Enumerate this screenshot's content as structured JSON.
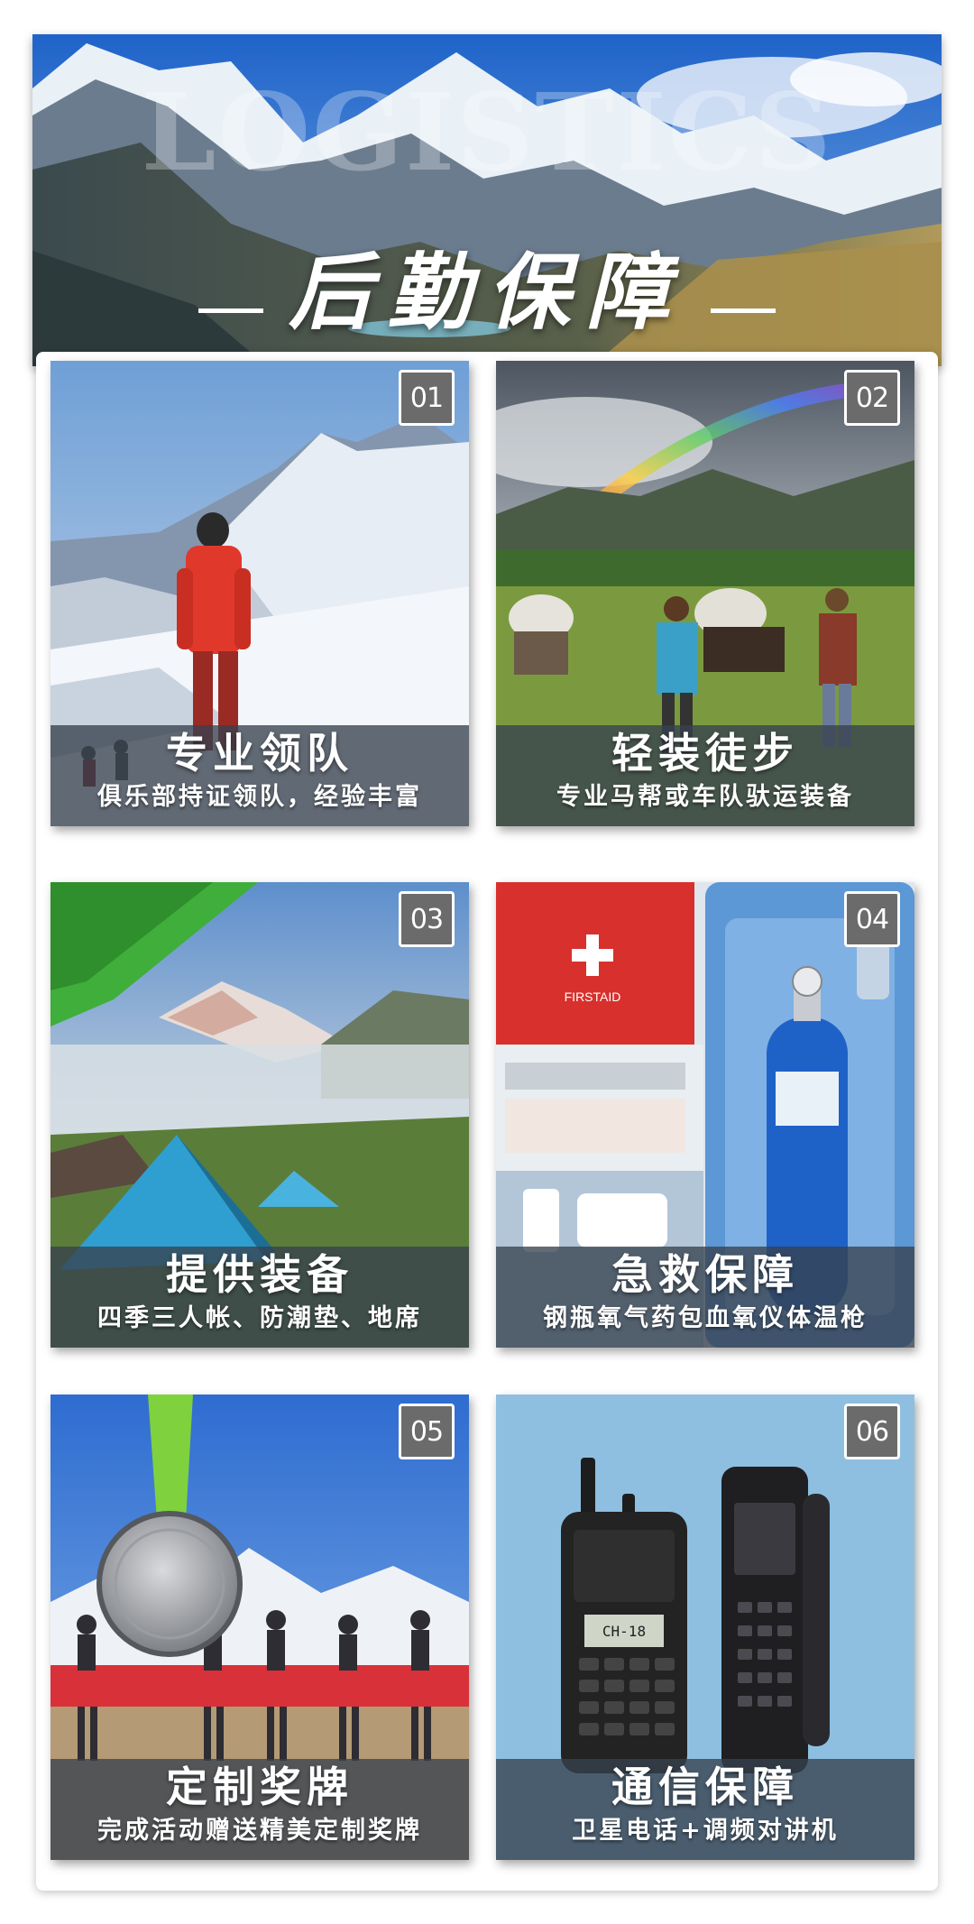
{
  "banner": {
    "watermark": "LOGISTICS",
    "title": "后勤保障"
  },
  "tiles": [
    {
      "num": "01",
      "title": "专业领队",
      "subtitle": "俱乐部持证领队，经验丰富"
    },
    {
      "num": "02",
      "title": "轻装徒步",
      "subtitle": "专业马帮或车队驮运装备"
    },
    {
      "num": "03",
      "title": "提供装备",
      "subtitle": "四季三人帐、防潮垫、地席"
    },
    {
      "num": "04",
      "title": "急救保障",
      "subtitle": "钢瓶氧气药包血氧仪体温枪",
      "kit_label": "FIRSTAID"
    },
    {
      "num": "05",
      "title": "定制奖牌",
      "subtitle": "完成活动赠送精美定制奖牌"
    },
    {
      "num": "06",
      "title": "通信保障",
      "subtitle": "卫星电话+调频对讲机",
      "radio_display": "CH-18"
    }
  ]
}
